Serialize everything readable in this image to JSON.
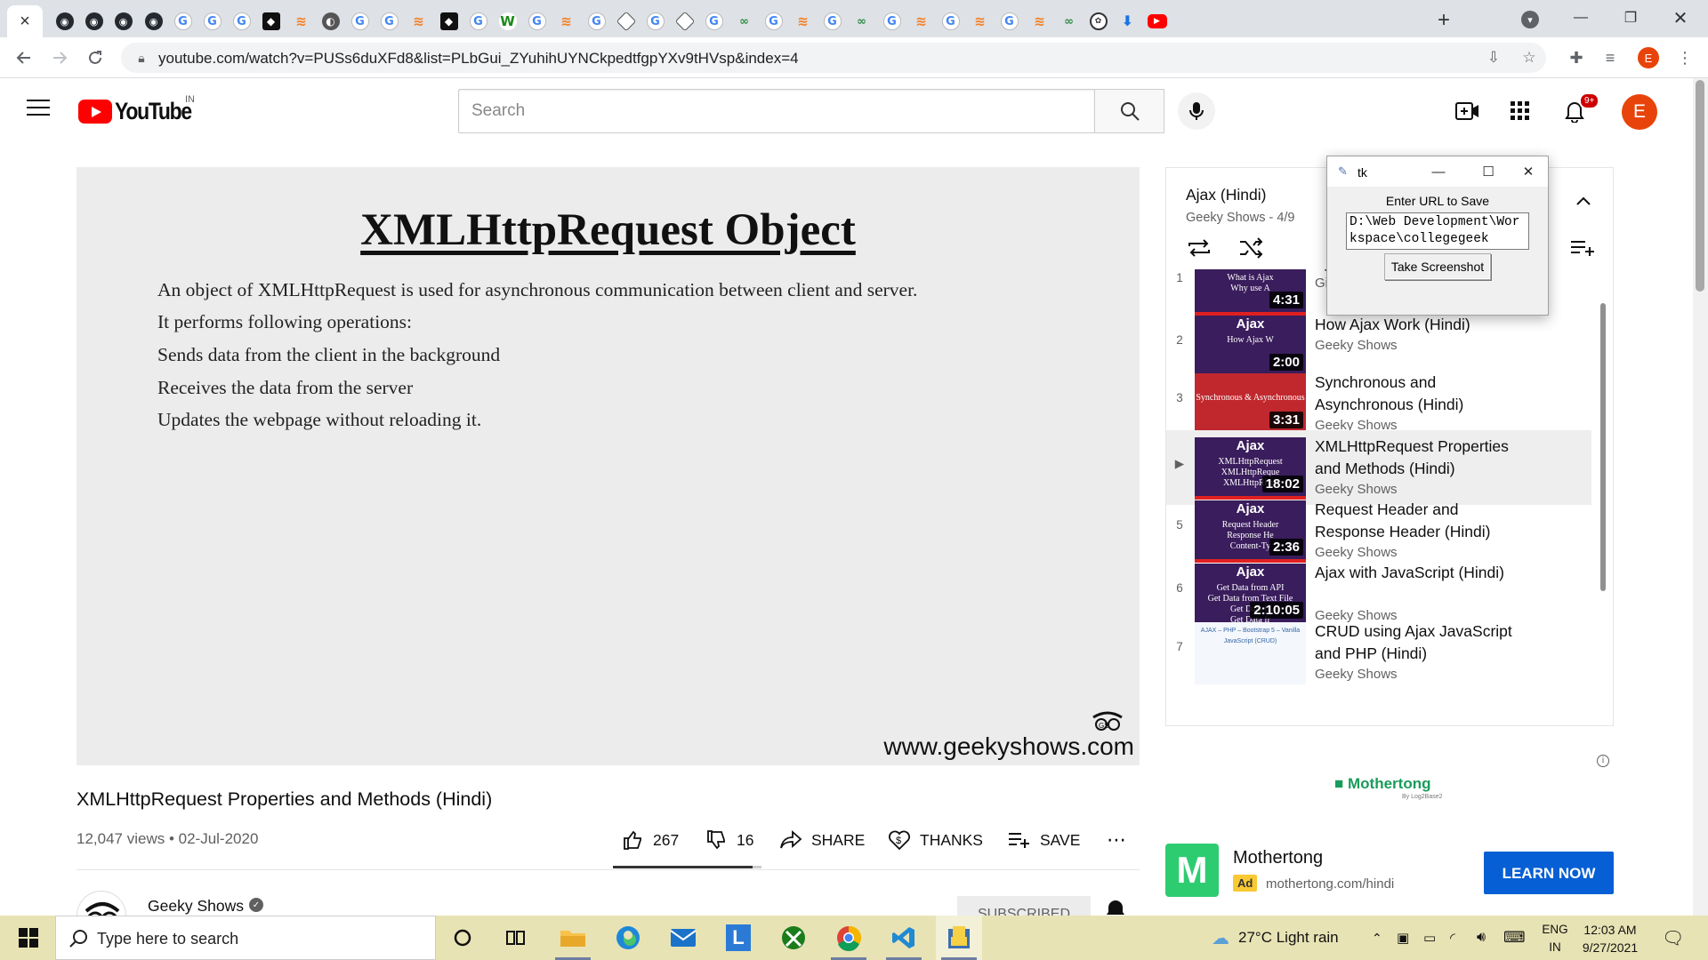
{
  "browser": {
    "active_tab_close": "×",
    "new_tab": "+",
    "tabs": [
      {
        "icon": "github-icon",
        "glyph": "◉",
        "kind": "github"
      },
      {
        "icon": "github-icon",
        "glyph": "◉",
        "kind": "github"
      },
      {
        "icon": "github-icon",
        "glyph": "◉",
        "kind": "github"
      },
      {
        "icon": "github-icon",
        "glyph": "◉",
        "kind": "github"
      },
      {
        "icon": "google-icon",
        "glyph": "G",
        "kind": "google"
      },
      {
        "icon": "google-icon",
        "glyph": "G",
        "kind": "google"
      },
      {
        "icon": "google-icon",
        "glyph": "G",
        "kind": "google"
      },
      {
        "icon": "dark-square-icon",
        "glyph": "◆",
        "kind": "dark"
      },
      {
        "icon": "stackoverflow-icon",
        "glyph": "≋",
        "kind": "so"
      },
      {
        "icon": "globe-icon",
        "glyph": "◐",
        "kind": "globe"
      },
      {
        "icon": "google-icon",
        "glyph": "G",
        "kind": "google"
      },
      {
        "icon": "google-icon",
        "glyph": "G",
        "kind": "google"
      },
      {
        "icon": "stackoverflow-icon",
        "glyph": "≋",
        "kind": "so"
      },
      {
        "icon": "dark-square-icon",
        "glyph": "◆",
        "kind": "dark"
      },
      {
        "icon": "google-icon",
        "glyph": "G",
        "kind": "google"
      },
      {
        "icon": "w-icon",
        "glyph": "W",
        "kind": "w"
      },
      {
        "icon": "google-icon",
        "glyph": "G",
        "kind": "google"
      },
      {
        "icon": "stackoverflow-icon",
        "glyph": "≋",
        "kind": "so"
      },
      {
        "icon": "google-icon",
        "glyph": "G",
        "kind": "google"
      },
      {
        "icon": "diamond-icon",
        "glyph": "",
        "kind": "diamond"
      },
      {
        "icon": "google-icon",
        "glyph": "G",
        "kind": "google"
      },
      {
        "icon": "diamond-icon",
        "glyph": "",
        "kind": "diamond"
      },
      {
        "icon": "google-icon",
        "glyph": "G",
        "kind": "google"
      },
      {
        "icon": "geeksforgeeks-icon",
        "glyph": "∞",
        "kind": "gfg"
      },
      {
        "icon": "google-icon",
        "glyph": "G",
        "kind": "google"
      },
      {
        "icon": "stackoverflow-icon",
        "glyph": "≋",
        "kind": "so"
      },
      {
        "icon": "google-icon",
        "glyph": "G",
        "kind": "google"
      },
      {
        "icon": "geeksforgeeks-icon",
        "glyph": "∞",
        "kind": "gfg"
      },
      {
        "icon": "google-icon",
        "glyph": "G",
        "kind": "google"
      },
      {
        "icon": "stackoverflow-icon",
        "glyph": "≋",
        "kind": "so"
      },
      {
        "icon": "google-icon",
        "glyph": "G",
        "kind": "google"
      },
      {
        "icon": "stackoverflow-icon",
        "glyph": "≋",
        "kind": "so"
      },
      {
        "icon": "google-icon",
        "glyph": "G",
        "kind": "google"
      },
      {
        "icon": "stackoverflow-icon",
        "glyph": "≋",
        "kind": "so"
      },
      {
        "icon": "geeksforgeeks-icon",
        "glyph": "∞",
        "kind": "gfg"
      },
      {
        "icon": "chatgpt-icon",
        "glyph": "✿",
        "kind": "chatgpt"
      },
      {
        "icon": "download-icon",
        "glyph": "⬇",
        "kind": "dl"
      },
      {
        "icon": "youtube-icon",
        "glyph": "▶",
        "kind": "yt"
      }
    ],
    "url": "youtube.com/watch?v=PUSs6duXFd8&list=PLbGui_ZYuhihUYNCkpedtfgpYXv9tHVsp&index=4",
    "profile_initial": "E"
  },
  "youtube": {
    "logo_text": "YouTube",
    "region": "IN",
    "search_placeholder": "Search",
    "notification_count": "9+",
    "avatar_initial": "E"
  },
  "slide": {
    "title": "XMLHttpRequest Object",
    "lines": [
      "An object of XMLHttpRequest is used for asynchronous communication between client and server.",
      "It performs following operations:",
      "Sends data from the client in the background",
      "Receives the data from the server",
      "Updates the webpage without reloading it."
    ],
    "watermark": "www.geekyshows.com",
    "watermark_logo": "GS"
  },
  "video": {
    "title": "XMLHttpRequest Properties and Methods (Hindi)",
    "meta": "12,047 views • 02-Jul-2020",
    "likes": "267",
    "dislikes": "16",
    "like_ratio": 0.943,
    "share_label": "SHARE",
    "thanks_label": "THANKS",
    "save_label": "SAVE",
    "more_label": "⋯",
    "channel": "Geeky Shows",
    "subscribe_label": "SUBSCRIBED"
  },
  "playlist": {
    "title": "Ajax (Hindi)",
    "subtitle": "Geeky Shows - 4/9",
    "items": [
      {
        "index": "1",
        "thumb_head": "",
        "thumb_body": "What is Ajax\nWhy use A",
        "duration": "4:31",
        "title": "Aj",
        "channel": "Gi",
        "thumb_color": "#3a1d5c"
      },
      {
        "index": "2",
        "thumb_head": "Ajax",
        "thumb_body": "How Ajax W",
        "duration": "2:00",
        "title": "How Ajax Work (Hindi)",
        "channel": "Geeky Shows",
        "thumb_color": "#3a1d5c"
      },
      {
        "index": "3",
        "thumb_head": "",
        "thumb_body": "Synchronous & Asynchronous",
        "duration": "3:31",
        "title": "Synchronous and Asynchronous (Hindi)",
        "channel": "Geeky Shows",
        "thumb_color": "#c0282e"
      },
      {
        "index": "▶",
        "thumb_head": "Ajax",
        "thumb_body": "XMLHttpRequest\nXMLHttpReque\nXMLHttpRequ",
        "duration": "18:02",
        "title": "XMLHttpRequest Properties and Methods (Hindi)",
        "channel": "Geeky Shows",
        "thumb_color": "#3a1d5c"
      },
      {
        "index": "5",
        "thumb_head": "Ajax",
        "thumb_body": "Request Header\nResponse He\nContent-Ty",
        "duration": "2:36",
        "title": "Request Header and Response Header (Hindi)",
        "channel": "Geeky Shows",
        "thumb_color": "#3a1d5c"
      },
      {
        "index": "6",
        "thumb_head": "Ajax",
        "thumb_body": "Get Data from API\nGet Data from Text File\nGet Data fr\nGet Data fr",
        "duration": "2:10:05",
        "title": "Ajax with JavaScript (Hindi)",
        "channel": "Geeky Shows",
        "thumb_color": "#3a1d5c"
      },
      {
        "index": "7",
        "thumb_head": "",
        "thumb_body": "AJAX – PHP – Bootstrap 5 – Vanilla JavaScript (CRUD)",
        "duration": "",
        "title": "CRUD using Ajax JavaScript and PHP (Hindi)",
        "channel": "Geeky Shows",
        "thumb_color": "#f4f7fb"
      }
    ]
  },
  "ad": {
    "brand": "Mothertong",
    "brand_sub": "By Log2Base2",
    "title": "Mothertong",
    "label": "Ad",
    "url": "mothertong.com/hindi",
    "cta": "LEARN NOW",
    "info": "i",
    "logo_letter": "M"
  },
  "tk_window": {
    "title": "tk",
    "label": "Enter URL to Save",
    "entry_value": "D:\\Web Development\\Workspace\\collegegeek",
    "button_label": "Take Screenshot"
  },
  "taskbar": {
    "search_placeholder": "Type here to search",
    "weather": "27°C  Light rain",
    "lang_line1": "ENG",
    "lang_line2": "IN",
    "time": "12:03 AM",
    "date": "9/27/2021"
  }
}
